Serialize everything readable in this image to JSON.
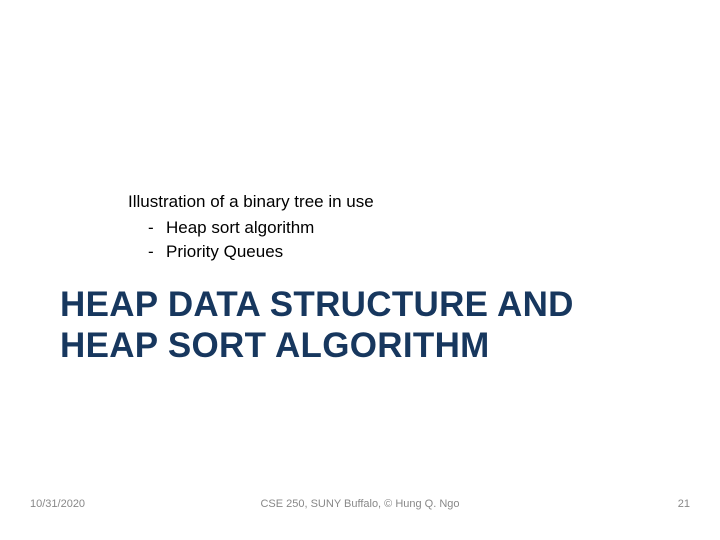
{
  "intro": {
    "line": "Illustration of a binary tree in use",
    "bullets": [
      "Heap sort algorithm",
      "Priority Queues"
    ]
  },
  "title": "HEAP DATA STRUCTURE AND HEAP SORT ALGORITHM",
  "footer": {
    "date": "10/31/2020",
    "center": "CSE 250, SUNY Buffalo, © Hung Q. Ngo",
    "page": "21"
  }
}
